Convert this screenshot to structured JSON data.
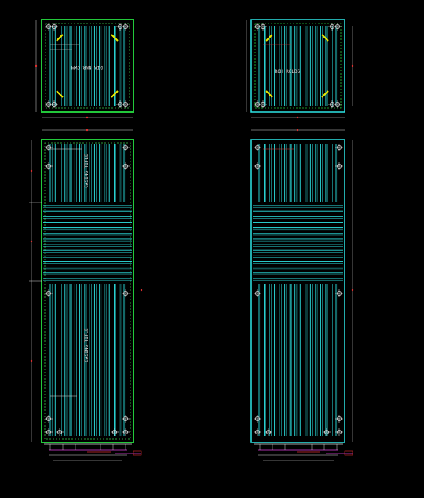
{
  "canvas": {
    "background": "#000000"
  },
  "colors": {
    "cyan": "#2ee6e6",
    "green": "#22c83a",
    "white": "#d8d8d8",
    "yellow": "#e8e800",
    "red": "#e03030",
    "magenta": "#e040e0",
    "dim_green": "#2a9a3a"
  },
  "labels": {
    "top_left_plan": "DIA NNR CWM",
    "top_right_plan": "ROH ROLDS",
    "left_elevation_upper": "CASING TITLE",
    "left_elevation_lower": "CASING TITLE"
  },
  "views": [
    {
      "id": "plan-left",
      "kind": "plan",
      "variant": "green-frame"
    },
    {
      "id": "plan-right",
      "kind": "plan",
      "variant": "cyan-frame"
    },
    {
      "id": "elevation-left",
      "kind": "elevation",
      "variant": "green-frame"
    },
    {
      "id": "elevation-right",
      "kind": "elevation",
      "variant": "cyan-frame"
    }
  ]
}
